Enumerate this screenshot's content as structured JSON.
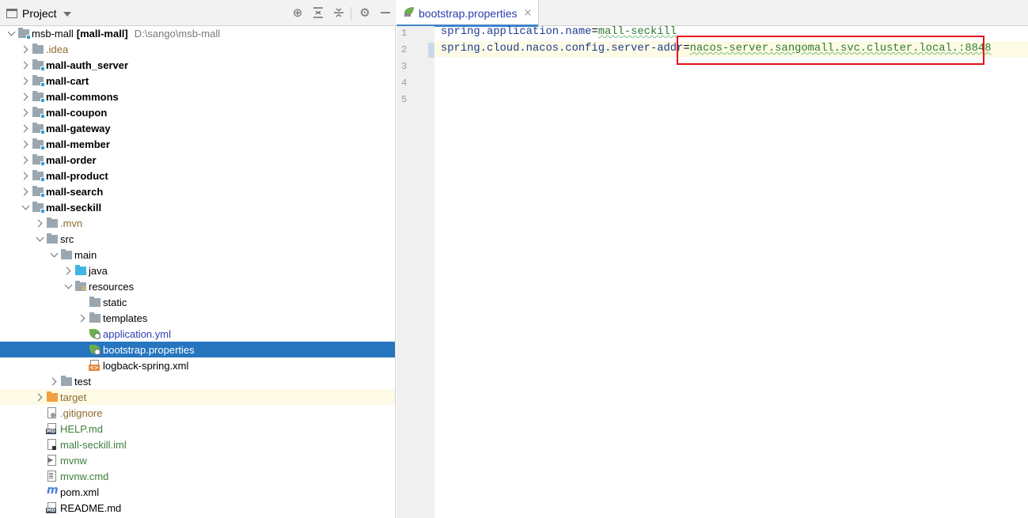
{
  "project_panel": {
    "title": "Project",
    "header_icons": [
      "locate-icon",
      "expand-all-icon",
      "collapse-all-icon",
      "settings-icon",
      "hide-icon"
    ],
    "tree": [
      {
        "label": "msb-mall",
        "suffix": "[mall-mall]",
        "path": "D:\\sango\\msb-mall",
        "level": 0,
        "arrow": "down",
        "icon": "module-folder",
        "style": "normal"
      },
      {
        "label": ".idea",
        "level": 1,
        "arrow": "right",
        "icon": "folder",
        "style": "brown"
      },
      {
        "label": "mall-auth_server",
        "level": 1,
        "arrow": "right",
        "icon": "module-folder",
        "style": "bold"
      },
      {
        "label": "mall-cart",
        "level": 1,
        "arrow": "right",
        "icon": "module-folder",
        "style": "bold"
      },
      {
        "label": "mall-commons",
        "level": 1,
        "arrow": "right",
        "icon": "module-folder",
        "style": "bold"
      },
      {
        "label": "mall-coupon",
        "level": 1,
        "arrow": "right",
        "icon": "module-folder",
        "style": "bold"
      },
      {
        "label": "mall-gateway",
        "level": 1,
        "arrow": "right",
        "icon": "module-folder",
        "style": "bold"
      },
      {
        "label": "mall-member",
        "level": 1,
        "arrow": "right",
        "icon": "module-folder",
        "style": "bold"
      },
      {
        "label": "mall-order",
        "level": 1,
        "arrow": "right",
        "icon": "module-folder",
        "style": "bold"
      },
      {
        "label": "mall-product",
        "level": 1,
        "arrow": "right",
        "icon": "module-folder",
        "style": "bold"
      },
      {
        "label": "mall-search",
        "level": 1,
        "arrow": "right",
        "icon": "module-folder",
        "style": "bold"
      },
      {
        "label": "mall-seckill",
        "level": 1,
        "arrow": "down",
        "icon": "module-folder",
        "style": "bold"
      },
      {
        "label": ".mvn",
        "level": 2,
        "arrow": "right",
        "icon": "folder",
        "style": "brown"
      },
      {
        "label": "src",
        "level": 2,
        "arrow": "down",
        "icon": "folder",
        "style": "normal"
      },
      {
        "label": "main",
        "level": 3,
        "arrow": "down",
        "icon": "folder",
        "style": "normal"
      },
      {
        "label": "java",
        "level": 4,
        "arrow": "right",
        "icon": "source-folder",
        "style": "normal"
      },
      {
        "label": "resources",
        "level": 4,
        "arrow": "down",
        "icon": "resources-folder",
        "style": "normal"
      },
      {
        "label": "static",
        "level": 5,
        "arrow": "none",
        "icon": "folder",
        "style": "normal"
      },
      {
        "label": "templates",
        "level": 5,
        "arrow": "right",
        "icon": "folder",
        "style": "normal"
      },
      {
        "label": "application.yml",
        "level": 5,
        "arrow": "none",
        "icon": "spring-yml-file",
        "style": "blue"
      },
      {
        "label": "bootstrap.properties",
        "level": 5,
        "arrow": "none",
        "icon": "spring-properties-file",
        "style": "selected"
      },
      {
        "label": "logback-spring.xml",
        "level": 5,
        "arrow": "none",
        "icon": "xml-file",
        "style": "normal"
      },
      {
        "label": "test",
        "level": 3,
        "arrow": "right",
        "icon": "folder",
        "style": "normal"
      },
      {
        "label": "target",
        "level": 2,
        "arrow": "right",
        "icon": "excluded-folder",
        "style": "brown-highlight"
      },
      {
        "label": ".gitignore",
        "level": 2,
        "arrow": "none",
        "icon": "gitignore-file",
        "style": "brown"
      },
      {
        "label": "HELP.md",
        "level": 2,
        "arrow": "none",
        "icon": "markdown-file",
        "style": "green"
      },
      {
        "label": "mall-seckill.iml",
        "level": 2,
        "arrow": "none",
        "icon": "iml-file",
        "style": "green"
      },
      {
        "label": "mvnw",
        "level": 2,
        "arrow": "none",
        "icon": "script-file",
        "style": "green"
      },
      {
        "label": "mvnw.cmd",
        "level": 2,
        "arrow": "none",
        "icon": "cmd-file",
        "style": "green"
      },
      {
        "label": "pom.xml",
        "level": 2,
        "arrow": "none",
        "icon": "maven-file",
        "style": "normal"
      },
      {
        "label": "README.md",
        "level": 2,
        "arrow": "none",
        "icon": "markdown-file",
        "style": "normal"
      }
    ]
  },
  "editor": {
    "tab": {
      "label": "bootstrap.properties",
      "close": "×",
      "icon": "spring-properties-icon"
    },
    "line_numbers": [
      "1",
      "2",
      "3",
      "4",
      "5"
    ],
    "lines": [
      {
        "key": "spring.application.name",
        "sep": "=",
        "value": "mall-seckill"
      },
      {
        "key": "spring.cloud.nacos.config.server-addr",
        "sep": "=",
        "value": "nacos-server.sangomall.svc.cluster.local.:8848"
      }
    ],
    "highlight_color": "#e8111b"
  },
  "colors": {
    "selection": "#2675bf",
    "property_key": "#1d3d8f",
    "property_value": "#2f7a2f",
    "current_line": "#fdfbe6"
  }
}
